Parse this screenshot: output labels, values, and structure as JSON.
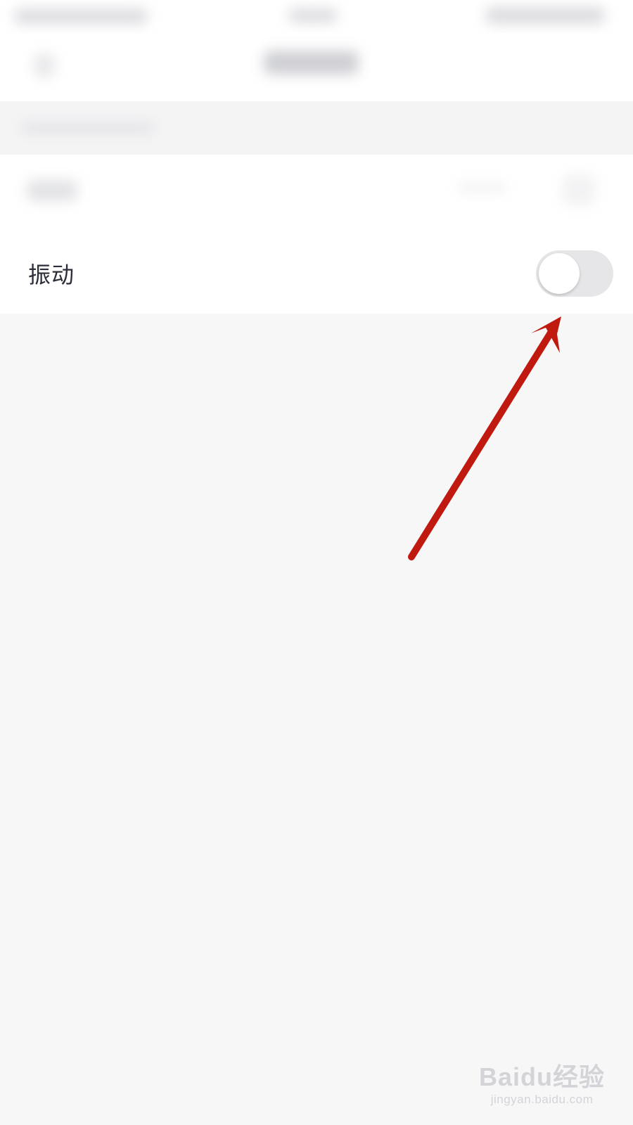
{
  "settings": {
    "vibration_label": "振动",
    "vibration_enabled": false
  },
  "annotation": {
    "arrow_color": "#c0190f"
  },
  "watermark": {
    "logo_text": "Baidu经验",
    "url_text": "jingyan.baidu.com"
  },
  "colors": {
    "background": "#f7f7f8",
    "card": "#ffffff",
    "label": "#2c2f3a",
    "toggle_off_track": "#e6e6e9"
  }
}
